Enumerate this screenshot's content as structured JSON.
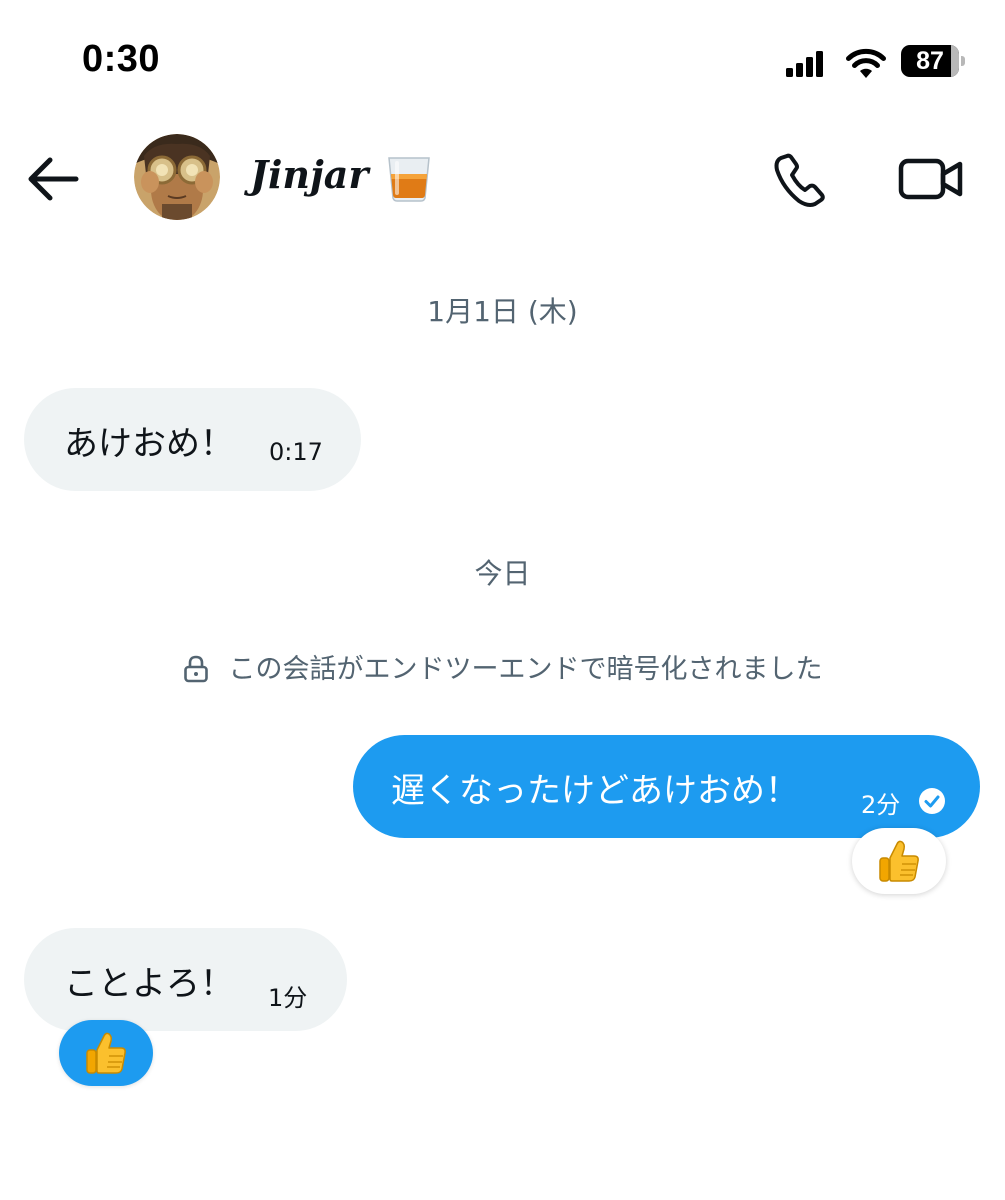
{
  "status_bar": {
    "time": "0:30",
    "battery_level": "87",
    "battery_fraction": 0.87
  },
  "header": {
    "back_icon": "arrow-left-icon",
    "contact_name": "Jinjar",
    "name_emoji_icon": "tumbler-glass-icon",
    "call_icon": "phone-icon",
    "video_icon": "video-camera-icon"
  },
  "chat": {
    "date_dividers": [
      "1月1日 (木)",
      "今日"
    ],
    "encryption_notice": "この会話がエンドツーエンドで暗号化されました",
    "messages": [
      {
        "direction": "incoming",
        "text": "あけおめ！",
        "time": "0:17"
      },
      {
        "direction": "outgoing",
        "text": "遅くなったけどあけおめ！",
        "time": "2分",
        "status_icon": "read-check-icon",
        "reaction": "thumbs-up-icon"
      },
      {
        "direction": "incoming",
        "text": "ことよろ！",
        "time": "1分",
        "reaction": "thumbs-up-icon"
      }
    ]
  },
  "colors": {
    "accent": "#1d9bf0",
    "incoming_bubble": "#eff3f4",
    "secondary_text": "#536471",
    "primary_text": "#0f1419"
  }
}
